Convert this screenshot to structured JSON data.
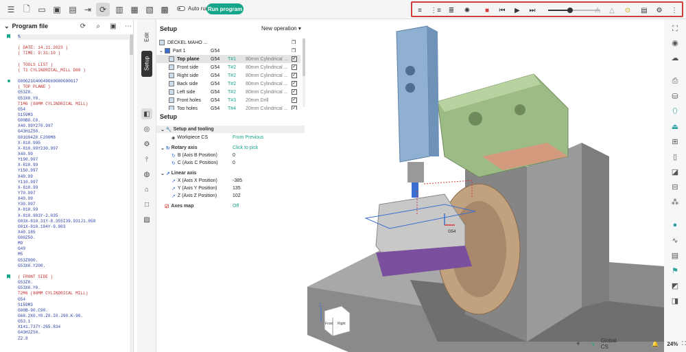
{
  "toolbar": {
    "auto_run_label": "Auto run",
    "run_program_label": "Run program"
  },
  "program": {
    "title": "Program file",
    "lines": [
      {
        "t": "%",
        "c": "",
        "m": "bk",
        "hl": true
      },
      {
        "t": "",
        "c": "",
        "m": ""
      },
      {
        "t": "( DATE: 14.11.2023 )",
        "c": "cmt",
        "m": ""
      },
      {
        "t": "( TIME: 9:31:10 )",
        "c": "cmt",
        "m": ""
      },
      {
        "t": "",
        "c": "",
        "m": ""
      },
      {
        "t": "( TOOLS LIST )",
        "c": "cmt",
        "m": ""
      },
      {
        "t": "( T1 CYLINDRICAL_MILL D80 )",
        "c": "cmt",
        "m": ""
      },
      {
        "t": "",
        "c": "",
        "m": ""
      },
      {
        "t": "G00G21G40G49G69G80G90G17",
        "c": "",
        "m": "dot"
      },
      {
        "t": "( TOP PLANE )",
        "c": "cmt",
        "m": ""
      },
      {
        "t": "G53Z0.",
        "c": "",
        "m": ""
      },
      {
        "t": "G53X0.Y0.",
        "c": "",
        "m": ""
      },
      {
        "t": "T1M6 (80MM CYLINDRICAL MILL)",
        "c": "cmt",
        "m": ""
      },
      {
        "t": "G54",
        "c": "",
        "m": ""
      },
      {
        "t": "S159M3",
        "c": "",
        "m": ""
      },
      {
        "t": "G00B0.C0.",
        "c": "",
        "m": ""
      },
      {
        "t": "X40.99Y270.997",
        "c": "",
        "m": ""
      },
      {
        "t": "G43H1Z50.",
        "c": "",
        "m": ""
      },
      {
        "t": "G01G94Z0.F200M8",
        "c": "",
        "m": ""
      },
      {
        "t": "X-810.995",
        "c": "",
        "m": ""
      },
      {
        "t": "X-810.99Y230.997",
        "c": "",
        "m": ""
      },
      {
        "t": "X40.99",
        "c": "",
        "m": ""
      },
      {
        "t": "Y190.997",
        "c": "",
        "m": ""
      },
      {
        "t": "X-810.99",
        "c": "",
        "m": ""
      },
      {
        "t": "Y150.997",
        "c": "",
        "m": ""
      },
      {
        "t": "X40.99",
        "c": "",
        "m": ""
      },
      {
        "t": "Y110.997",
        "c": "",
        "m": ""
      },
      {
        "t": "X-810.99",
        "c": "",
        "m": ""
      },
      {
        "t": "Y70.997",
        "c": "",
        "m": ""
      },
      {
        "t": "X40.99",
        "c": "",
        "m": ""
      },
      {
        "t": "Y30.997",
        "c": "",
        "m": ""
      },
      {
        "t": "X-810.99",
        "c": "",
        "m": ""
      },
      {
        "t": "X-810.983Y-2.035",
        "c": "",
        "m": ""
      },
      {
        "t": "G03X-810.31Y-8.355I39.931J1.058",
        "c": "",
        "m": ""
      },
      {
        "t": "G01X-810.184Y-9.003",
        "c": "",
        "m": ""
      },
      {
        "t": "X40.185",
        "c": "",
        "m": ""
      },
      {
        "t": "G00Z50.",
        "c": "",
        "m": ""
      },
      {
        "t": "M9",
        "c": "",
        "m": ""
      },
      {
        "t": "G49",
        "c": "",
        "m": ""
      },
      {
        "t": "M5",
        "c": "",
        "m": ""
      },
      {
        "t": "G53Z800.",
        "c": "",
        "m": ""
      },
      {
        "t": "G53X0.Y200.",
        "c": "",
        "m": ""
      },
      {
        "t": "",
        "c": "",
        "m": ""
      },
      {
        "t": "( FRONT SIDE )",
        "c": "cmt",
        "m": "bk"
      },
      {
        "t": "G53Z0.",
        "c": "",
        "m": ""
      },
      {
        "t": "G53X0.Y0.",
        "c": "",
        "m": ""
      },
      {
        "t": "T2M6 (80MM CYLINDRICAL MILL)",
        "c": "cmt",
        "m": ""
      },
      {
        "t": "G54",
        "c": "",
        "m": ""
      },
      {
        "t": "S159M3",
        "c": "",
        "m": ""
      },
      {
        "t": "G00B-90.C90.",
        "c": "",
        "m": ""
      },
      {
        "t": "G68.2X0.Y0.Z0.I0.J90.K-90.",
        "c": "",
        "m": ""
      },
      {
        "t": "G53.1",
        "c": "",
        "m": ""
      },
      {
        "t": "X141.737Y-265.834",
        "c": "",
        "m": ""
      },
      {
        "t": "G43H2Z50.",
        "c": "",
        "m": ""
      },
      {
        "t": "Z2.8",
        "c": "",
        "m": ""
      }
    ]
  },
  "tabs": {
    "edit": "Edit",
    "setup": "Setup"
  },
  "setup": {
    "title": "Setup",
    "new_operation": "New operation",
    "machine": "DECKEL MAHO ...",
    "part": "Part 1",
    "part_wcs": "G54",
    "operations": [
      {
        "name": "Top plane",
        "wcs": "G54",
        "tool": "T#1",
        "desc": "80mm Cylindrical ...",
        "sel": true
      },
      {
        "name": "Front side",
        "wcs": "G54",
        "tool": "T#2",
        "desc": "80mm Cylindrical ...",
        "sel": false
      },
      {
        "name": "Right side",
        "wcs": "G54",
        "tool": "T#2",
        "desc": "80mm Cylindrical ...",
        "sel": false
      },
      {
        "name": "Back side",
        "wcs": "G54",
        "tool": "T#2",
        "desc": "80mm Cylindrical ...",
        "sel": false
      },
      {
        "name": "Left side",
        "wcs": "G54",
        "tool": "T#2",
        "desc": "80mm Cylindrical ...",
        "sel": false
      },
      {
        "name": "Front holes",
        "wcs": "G54",
        "tool": "T#3",
        "desc": "20mm Drill",
        "sel": false
      },
      {
        "name": "Top holes",
        "wcs": "G54",
        "tool": "T#4",
        "desc": "20mm Cylindrical ...",
        "sel": false
      }
    ],
    "section_title": "Setup",
    "props": {
      "setup_tooling": "Setup and tooling",
      "workpiece_cs": "Workpiece CS",
      "workpiece_cs_value": "From Previous",
      "rotary_axis": "Rotary axis",
      "rotary_axis_value": "Click to pick",
      "b_axis": "B (Axis B Position)",
      "b_value": "0",
      "c_axis": "C (Axis C Position)",
      "c_value": "0",
      "linear_axis": "Linear axis",
      "x_axis": "X (Axis X Position)",
      "x_value": "-385",
      "y_axis": "Y (Axis Y Position)",
      "y_value": "135",
      "z_axis": "Z (Axis Z Position)",
      "z_value": "102",
      "axes_map": "Axes map",
      "axes_map_value": "Off"
    }
  },
  "viewport": {
    "cube_front": "Front",
    "cube_right": "Right",
    "axis_z": "Z",
    "wcs_label": "G54"
  },
  "status": {
    "cs_label": "Global CS",
    "zoom": "24%"
  },
  "colors": {
    "accent": "#15a589",
    "highlight_border": "#d23b3b"
  }
}
